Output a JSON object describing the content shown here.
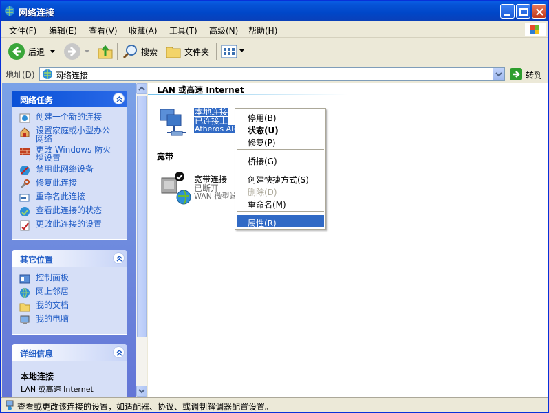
{
  "window": {
    "title": "网络连接"
  },
  "menu": [
    "文件(F)",
    "编辑(E)",
    "查看(V)",
    "收藏(A)",
    "工具(T)",
    "高级(N)",
    "帮助(H)"
  ],
  "toolbar": {
    "back": "后退",
    "search": "搜索",
    "folders": "文件夹"
  },
  "address": {
    "label": "地址(D)",
    "value": "网络连接",
    "go": "转到"
  },
  "network_tasks": {
    "title": "网络任务",
    "items": [
      "创建一个新的连接",
      "设置家庭或小型办公网络",
      "更改 Windows 防火墙设置",
      "禁用此网络设备",
      "修复此连接",
      "重命名此连接",
      "查看此连接的状态",
      "更改此连接的设置"
    ]
  },
  "other_places": {
    "title": "其它位置",
    "items": [
      "控制面板",
      "网上邻居",
      "我的文档",
      "我的电脑"
    ]
  },
  "details": {
    "title": "详细信息",
    "name": "本地连接",
    "type": "LAN 或高速 Internet"
  },
  "groups": {
    "lan": "LAN 或高速 Internet",
    "broadband": "宽带"
  },
  "connections": {
    "local": {
      "name": "本地连接",
      "status": "已连接上",
      "device": "Atheros AR"
    },
    "broadband": {
      "name": "宽带连接",
      "status": "已断开",
      "device": "WAN 微型端"
    }
  },
  "context_menu": [
    {
      "label": "停用(B)",
      "state": "normal"
    },
    {
      "label": "状态(U)",
      "state": "bold"
    },
    {
      "label": "修复(P)",
      "state": "normal"
    },
    {
      "label": "桥接(G)",
      "state": "normal"
    },
    {
      "label": "创建快捷方式(S)",
      "state": "normal"
    },
    {
      "label": "删除(D)",
      "state": "disabled"
    },
    {
      "label": "重命名(M)",
      "state": "normal"
    },
    {
      "label": "属性(R)",
      "state": "selected"
    }
  ],
  "status": "查看或更改该连接的设置，如适配器、协议、或调制解调器配置设置。",
  "colors": {
    "titlebar": "#0054E3",
    "link": "#215DC6",
    "selection": "#316AC5",
    "pane": "#7BA2E7"
  }
}
